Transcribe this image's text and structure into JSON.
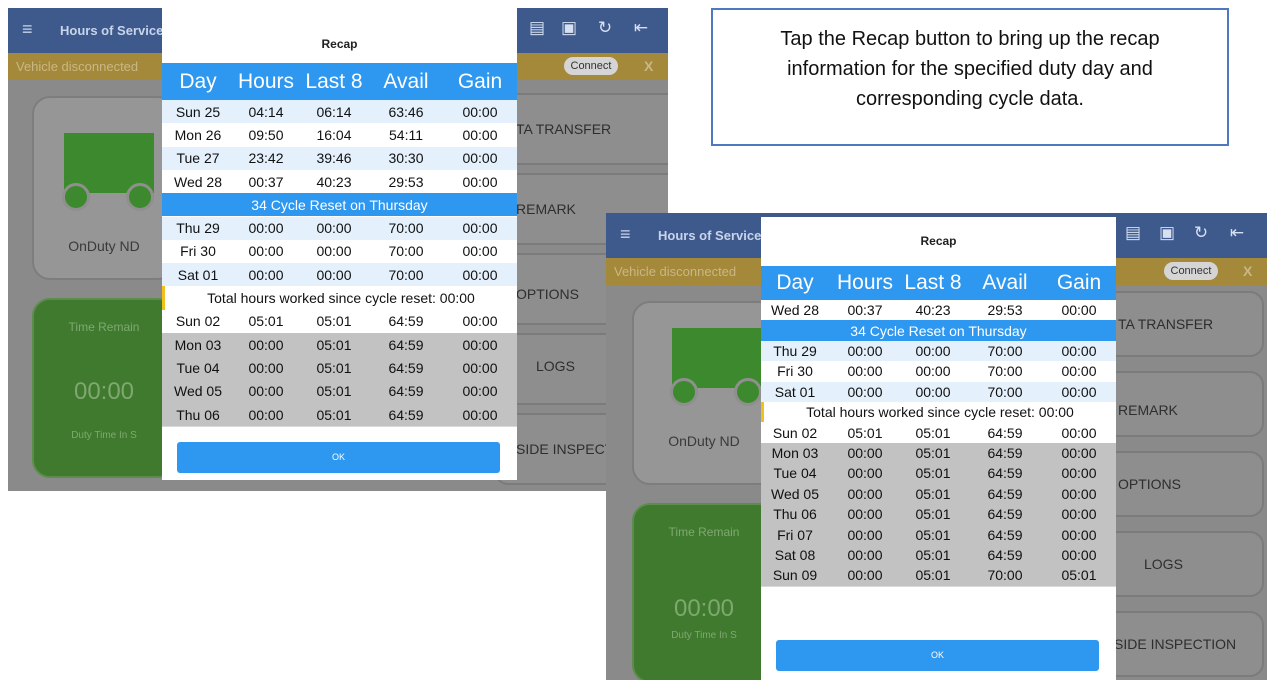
{
  "caption": {
    "text": "Tap the Recap button to bring up the recap information for the specified duty day and corresponding cycle data."
  },
  "screen1": {
    "app_title": "Hours of Service",
    "warning": "Vehicle disconnected",
    "connect_label": "Connect",
    "close_label": "X",
    "duty_status": "OnDuty ND",
    "time_remaining_label": "Time Remain",
    "time_value": "00:00",
    "duty_time_label": "Duty Time In S",
    "right_buttons": [
      "TA TRANSFER",
      "REMARK",
      "OPTIONS",
      "LOGS",
      "SIDE INSPECT"
    ],
    "dialog": {
      "title": "Recap",
      "headers": [
        "Day",
        "Hours",
        "Last 8",
        "Avail",
        "Gain"
      ],
      "rows_before": [
        {
          "cells": [
            "Sun 25",
            "04:14",
            "06:14",
            "63:46",
            "00:00"
          ],
          "style": "light"
        },
        {
          "cells": [
            "Mon 26",
            "09:50",
            "16:04",
            "54:11",
            "00:00"
          ],
          "style": "white"
        },
        {
          "cells": [
            "Tue 27",
            "23:42",
            "39:46",
            "30:30",
            "00:00"
          ],
          "style": "light"
        },
        {
          "cells": [
            "Wed 28",
            "00:37",
            "40:23",
            "29:53",
            "00:00"
          ],
          "style": "white"
        }
      ],
      "reset_text": "34 Cycle Reset on Thursday",
      "rows_middle": [
        {
          "cells": [
            "Thu 29",
            "00:00",
            "00:00",
            "70:00",
            "00:00"
          ],
          "style": "light"
        },
        {
          "cells": [
            "Fri 30",
            "00:00",
            "00:00",
            "70:00",
            "00:00"
          ],
          "style": "white"
        },
        {
          "cells": [
            "Sat 01",
            "00:00",
            "00:00",
            "70:00",
            "00:00"
          ],
          "style": "light"
        }
      ],
      "total_text": "Total hours worked since cycle reset: 00:00",
      "rows_after": [
        {
          "cells": [
            "Sun 02",
            "05:01",
            "05:01",
            "64:59",
            "00:00"
          ],
          "style": "white"
        },
        {
          "cells": [
            "Mon 03",
            "00:00",
            "05:01",
            "64:59",
            "00:00"
          ],
          "style": "gray"
        },
        {
          "cells": [
            "Tue 04",
            "00:00",
            "05:01",
            "64:59",
            "00:00"
          ],
          "style": "gray"
        },
        {
          "cells": [
            "Wed 05",
            "00:00",
            "05:01",
            "64:59",
            "00:00"
          ],
          "style": "gray"
        },
        {
          "cells": [
            "Thu 06",
            "00:00",
            "05:01",
            "64:59",
            "00:00"
          ],
          "style": "gray"
        }
      ],
      "ok_label": "OK"
    }
  },
  "screen2": {
    "app_title": "Hours of Service",
    "warning": "Vehicle disconnected",
    "connect_label": "Connect",
    "close_label": "X",
    "duty_status": "OnDuty ND",
    "time_remaining_label": "Time Remain",
    "time_value": "00:00",
    "duty_time_label": "Duty Time In S",
    "right_buttons": [
      "TA TRANSFER",
      "REMARK",
      "OPTIONS",
      "LOGS",
      "SIDE INSPECTION"
    ],
    "dialog": {
      "title": "Recap",
      "headers": [
        "Day",
        "Hours",
        "Last 8",
        "Avail",
        "Gain"
      ],
      "rows_before": [
        {
          "cells": [
            "Wed 28",
            "00:37",
            "40:23",
            "29:53",
            "00:00"
          ],
          "style": "white"
        }
      ],
      "reset_text": "34 Cycle Reset on Thursday",
      "rows_middle": [
        {
          "cells": [
            "Thu 29",
            "00:00",
            "00:00",
            "70:00",
            "00:00"
          ],
          "style": "light"
        },
        {
          "cells": [
            "Fri 30",
            "00:00",
            "00:00",
            "70:00",
            "00:00"
          ],
          "style": "white"
        },
        {
          "cells": [
            "Sat 01",
            "00:00",
            "00:00",
            "70:00",
            "00:00"
          ],
          "style": "light"
        }
      ],
      "total_text": "Total hours worked since cycle reset: 00:00",
      "rows_after": [
        {
          "cells": [
            "Sun 02",
            "05:01",
            "05:01",
            "64:59",
            "00:00"
          ],
          "style": "white"
        },
        {
          "cells": [
            "Mon 03",
            "00:00",
            "05:01",
            "64:59",
            "00:00"
          ],
          "style": "gray"
        },
        {
          "cells": [
            "Tue 04",
            "00:00",
            "05:01",
            "64:59",
            "00:00"
          ],
          "style": "gray"
        },
        {
          "cells": [
            "Wed 05",
            "00:00",
            "05:01",
            "64:59",
            "00:00"
          ],
          "style": "gray"
        },
        {
          "cells": [
            "Thu 06",
            "00:00",
            "05:01",
            "64:59",
            "00:00"
          ],
          "style": "gray"
        },
        {
          "cells": [
            "Fri 07",
            "00:00",
            "05:01",
            "64:59",
            "00:00"
          ],
          "style": "gray"
        },
        {
          "cells": [
            "Sat 08",
            "00:00",
            "05:01",
            "64:59",
            "00:00"
          ],
          "style": "gray"
        },
        {
          "cells": [
            "Sun 09",
            "00:00",
            "05:01",
            "70:00",
            "05:01"
          ],
          "style": "gray"
        }
      ],
      "ok_label": "OK"
    }
  },
  "icons": [
    "menu-icon",
    "message-icon",
    "driver-icon",
    "refresh-icon",
    "logout-icon"
  ],
  "colors": {
    "header_blue": "#2e97f0",
    "appbar": "#3e5a8c",
    "warning_bar": "#a4893a",
    "green_tile": "#3f7a2f",
    "caption_border": "#4f79be"
  }
}
